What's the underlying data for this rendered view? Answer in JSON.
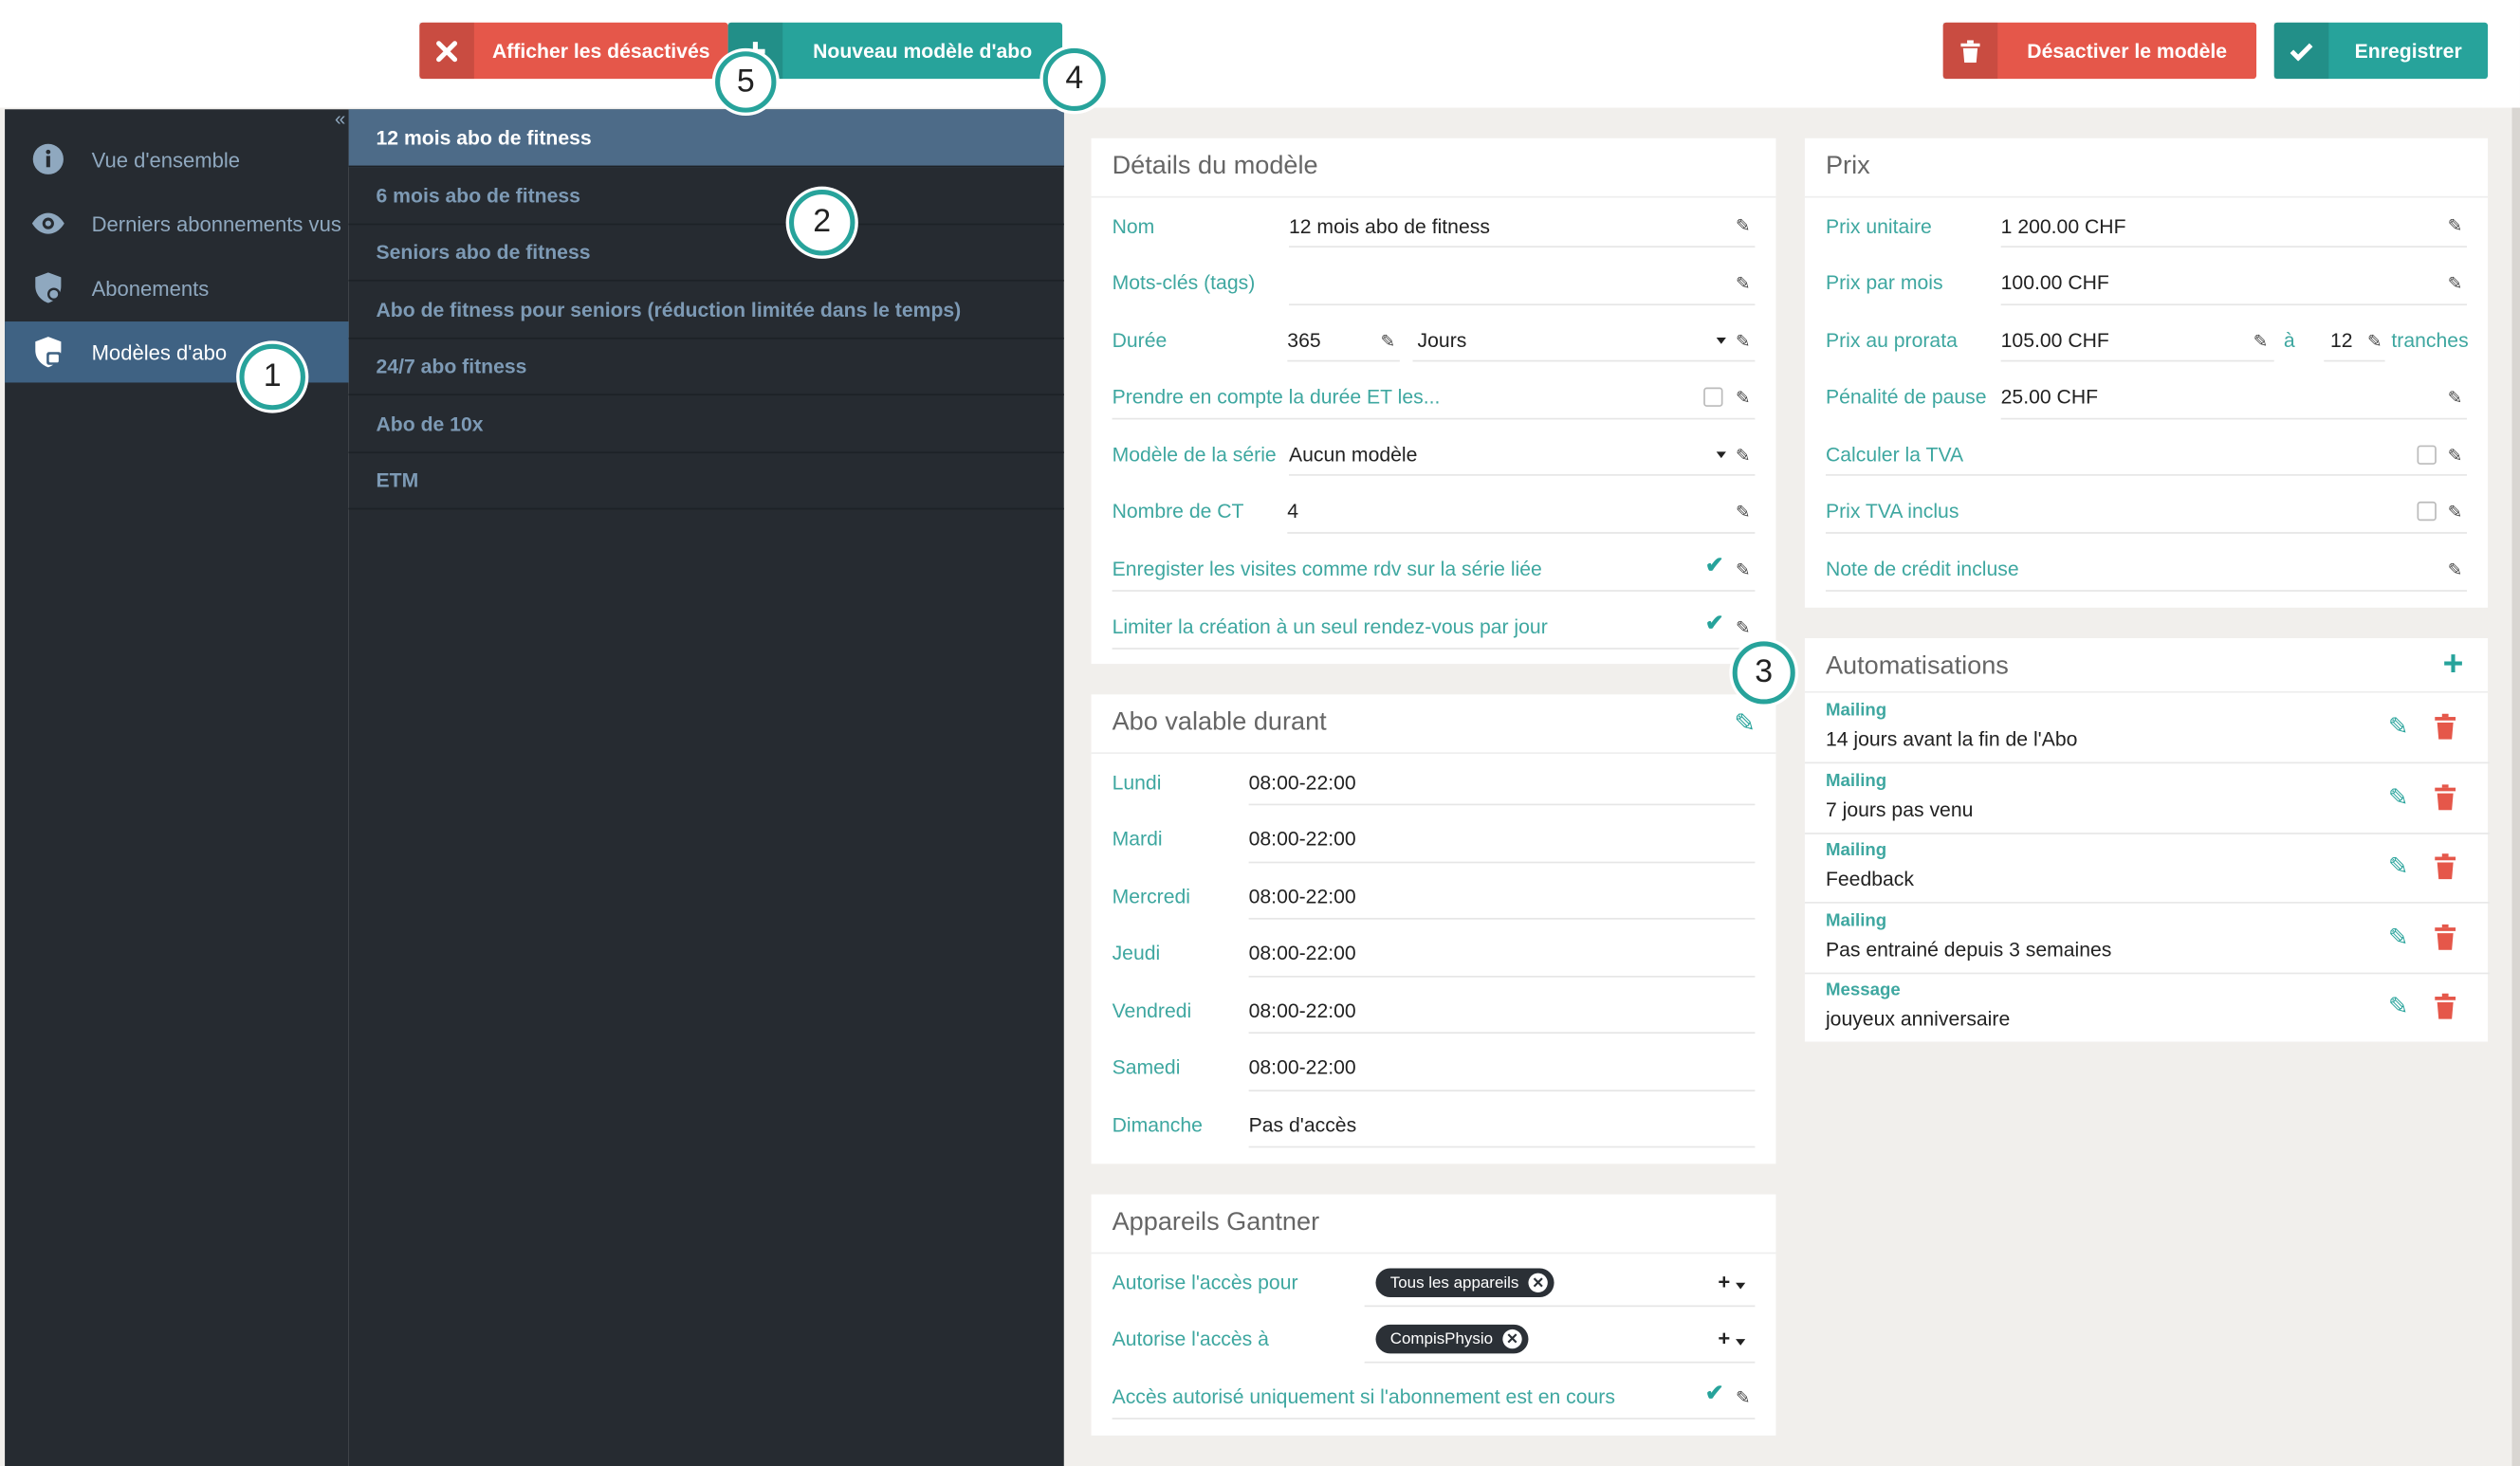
{
  "toolbar": {
    "show_disabled_label": "Afficher les désactivés",
    "new_model_label": "Nouveau modèle d'abo",
    "deactivate_label": "Désactiver le modèle",
    "save_label": "Enregistrer"
  },
  "colors": {
    "accent": "#27a39b",
    "danger": "#e5574a",
    "sidebar_bg": "#262b31",
    "active_nav": "#3f6283"
  },
  "sidebar": {
    "items": [
      {
        "label": "Vue d'ensemble",
        "icon": "info-icon"
      },
      {
        "label": "Derniers abonnements vus",
        "icon": "eye-icon"
      },
      {
        "label": "Abonements",
        "icon": "shield-icon"
      },
      {
        "label": "Modèles d'abo",
        "icon": "shield-template-icon",
        "active": true
      }
    ]
  },
  "models": [
    "12 mois abo de fitness",
    "6 mois abo de fitness",
    "Seniors abo de fitness",
    "Abo de fitness pour seniors (réduction limitée dans le temps)",
    "24/7 abo fitness",
    "Abo de 10x",
    "ETM"
  ],
  "details": {
    "title": "Détails du modèle",
    "name_label": "Nom",
    "name_value": "12 mois abo de fitness",
    "tags_label": "Mots-clés (tags)",
    "duration_label": "Durée",
    "duration_value": "365",
    "duration_unit": "Jours",
    "consider_label": "Prendre en compte la durée ET les...",
    "series_label": "Modèle de la série",
    "series_value": "Aucun modèle",
    "ct_label": "Nombre de CT",
    "ct_value": "4",
    "visits_label": "Enregister les visites comme rdv sur la série liée",
    "limit_label": "Limiter la création à un seul rendez-vous par jour"
  },
  "validity": {
    "title": "Abo valable durant",
    "days": [
      {
        "day": "Lundi",
        "hours": "08:00-22:00"
      },
      {
        "day": "Mardi",
        "hours": "08:00-22:00"
      },
      {
        "day": "Mercredi",
        "hours": "08:00-22:00"
      },
      {
        "day": "Jeudi",
        "hours": "08:00-22:00"
      },
      {
        "day": "Vendredi",
        "hours": "08:00-22:00"
      },
      {
        "day": "Samedi",
        "hours": "08:00-22:00"
      },
      {
        "day": "Dimanche",
        "hours": "Pas d'accès"
      }
    ]
  },
  "devices": {
    "title": "Appareils Gantner",
    "access_for_label": "Autorise l'accès pour",
    "access_for_tag": "Tous les appareils",
    "access_to_label": "Autorise l'accès à",
    "access_to_tag": "CompisPhysio",
    "only_active_label": "Accès autorisé uniquement si l'abonnement est en cours"
  },
  "price": {
    "title": "Prix",
    "unit_label": "Prix unitaire",
    "unit_value": "1 200.00 CHF",
    "month_label": "Prix par mois",
    "month_value": "100.00 CHF",
    "prorata_label": "Prix au prorata",
    "prorata_value": "105.00 CHF",
    "prorata_at": "à",
    "prorata_count": "12",
    "prorata_unit": "tranches",
    "pause_label": "Pénalité de pause",
    "pause_value": "25.00 CHF",
    "vat_label": "Calculer la TVA",
    "vat_incl_label": "Prix TVA inclus",
    "credit_label": "Note de crédit incluse"
  },
  "automations": {
    "title": "Automatisations",
    "items": [
      {
        "type": "Mailing",
        "desc": "14 jours avant la fin de l'Abo"
      },
      {
        "type": "Mailing",
        "desc": "7 jours pas venu"
      },
      {
        "type": "Mailing",
        "desc": "Feedback"
      },
      {
        "type": "Mailing",
        "desc": "Pas entrainé depuis 3 semaines"
      },
      {
        "type": "Message",
        "desc": "jouyeux anniversaire"
      }
    ]
  },
  "callouts": [
    "1",
    "2",
    "3",
    "4",
    "5"
  ]
}
